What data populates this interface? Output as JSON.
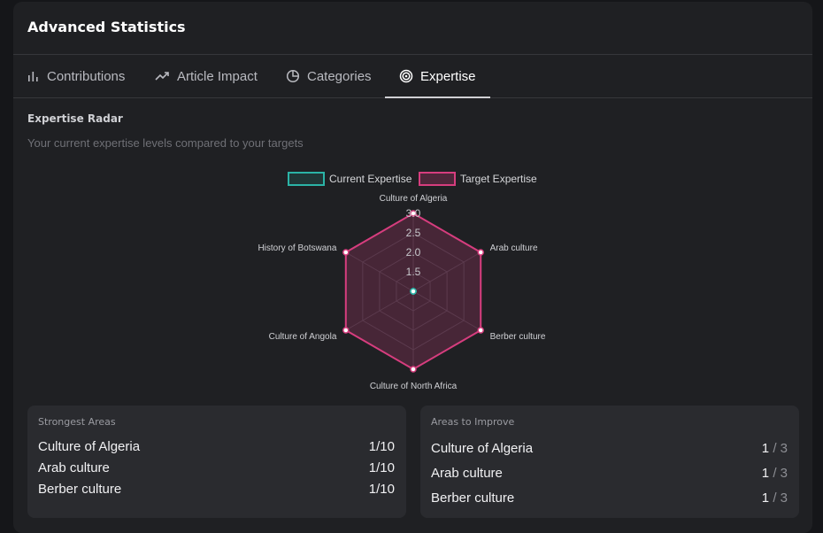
{
  "panel": {
    "title": "Advanced Statistics"
  },
  "tabs": [
    {
      "label": "Contributions",
      "icon": "bar-chart-icon"
    },
    {
      "label": "Article Impact",
      "icon": "trending-up-icon"
    },
    {
      "label": "Categories",
      "icon": "pie-chart-icon"
    },
    {
      "label": "Expertise",
      "icon": "target-icon",
      "active": true
    }
  ],
  "section": {
    "title": "Expertise Radar",
    "subtitle": "Your current expertise levels compared to your targets"
  },
  "chart_data": {
    "type": "radar",
    "categories": [
      "Culture of Algeria",
      "Arab culture",
      "Berber culture",
      "Culture of North Africa",
      "Culture of Angola",
      "History of Botswana"
    ],
    "series": [
      {
        "name": "Current Expertise",
        "values": [
          1,
          1,
          1,
          1,
          1,
          1
        ],
        "color": "#2bb3a6"
      },
      {
        "name": "Target Expertise",
        "values": [
          3,
          3,
          3,
          3,
          3,
          3
        ],
        "color": "#d63d7e"
      }
    ],
    "r_ticks": [
      "1.5",
      "2.0",
      "2.5",
      "3.0"
    ],
    "r_range": [
      1,
      3
    ],
    "legend": "top",
    "grid": true
  },
  "strongest": {
    "title": "Strongest Areas",
    "items": [
      {
        "name": "Culture of Algeria",
        "value": "1/10"
      },
      {
        "name": "Arab culture",
        "value": "1/10"
      },
      {
        "name": "Berber culture",
        "value": "1/10"
      }
    ]
  },
  "improve": {
    "title": "Areas to Improve",
    "items": [
      {
        "name": "Culture of Algeria",
        "current": "1",
        "target": "3"
      },
      {
        "name": "Arab culture",
        "current": "1",
        "target": "3"
      },
      {
        "name": "Berber culture",
        "current": "1",
        "target": "3"
      }
    ],
    "separator": "/"
  }
}
